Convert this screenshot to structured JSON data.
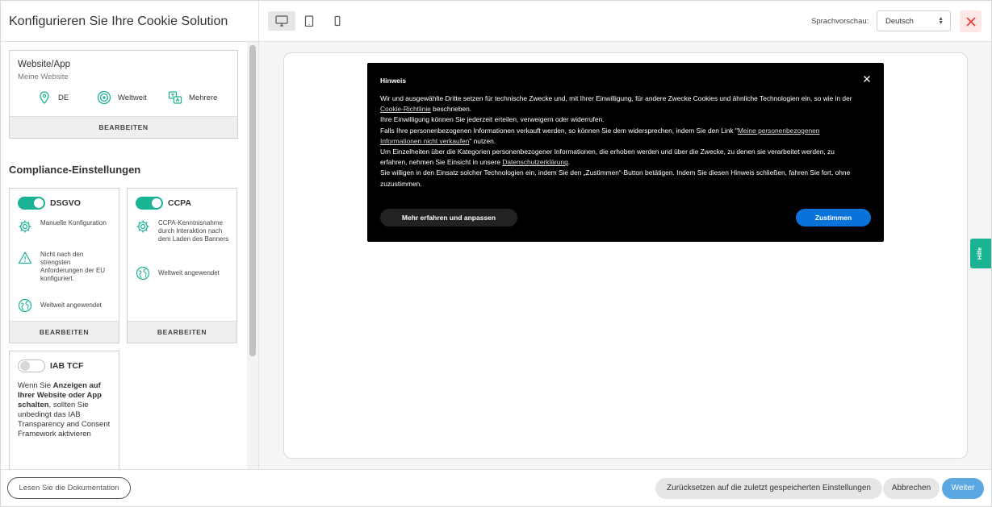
{
  "app_title": "Konfigurieren Sie Ihre Cookie Solution",
  "site_card": {
    "title": "Website/App",
    "subtitle": "Meine Website",
    "location": "DE",
    "scope": "Weltweit",
    "languages": "Mehrere",
    "edit_label": "BEARBEITEN"
  },
  "compliance": {
    "section_title": "Compliance-Einstellungen",
    "gdpr": {
      "label": "DSGVO",
      "enabled": true,
      "features": [
        "Manuelle Konfiguration",
        "Nicht nach den strengsten Anforderungen der EU konfiguriert.",
        "Weltweit angewendet"
      ],
      "edit_label": "BEARBEITEN"
    },
    "ccpa": {
      "label": "CCPA",
      "enabled": true,
      "features": [
        "CCPA-Kenntnisnahme durch Interaktion nach dem Laden des Banners",
        "Weltweit angewendet"
      ],
      "edit_label": "BEARBEITEN"
    },
    "iab": {
      "label": "IAB TCF",
      "enabled": false,
      "text_pre": "Wenn Sie ",
      "text_bold": "Anzeigen auf Ihrer Website oder App schalten",
      "text_post": ", sollten Sie unbedingt das IAB Transparency and Consent Framework aktivieren"
    }
  },
  "topbar": {
    "language_label": "Sprachvorschau:",
    "language_value": "Deutsch",
    "active_device": "desktop"
  },
  "banner": {
    "title": "Hinweis",
    "p1_pre": "Wir und ausgewählte Dritte setzen für technische Zwecke und, mit Ihrer Einwilligung, für andere Zwecke Cookies und ähnliche Technologien ein, so wie in der ",
    "p1_link": "Cookie-Richtlinie",
    "p1_post": " beschrieben.",
    "p2": "Ihre Einwilligung können Sie jederzeit erteilen, verweigern oder widerrufen.",
    "p3_pre": "Falls Ihre personenbezogenen Informationen verkauft werden, so können Sie dem widersprechen, indem Sie den Link \"",
    "p3_link": "Meine personenbezogenen Informationen nicht verkaufen",
    "p3_post": "\" nutzen.",
    "p4_pre": "Um Einzelheiten über die Kategorien personenbezogener Informationen, die erhoben werden und über die Zwecke, zu denen sie verarbeitet werden, zu erfahren, nehmen Sie Einsicht in unsere ",
    "p4_link": "Datenschutzerklärung",
    "p4_post": ".",
    "p5": "Sie willigen in den Einsatz solcher Technologien ein, indem Sie den „Zustimmen“-Button betätigen. Indem Sie diesen Hinweis schließen, fahren Sie fort, ohne zuzustimmen.",
    "learn_more": "Mehr erfahren und anpassen",
    "accept": "Zustimmen"
  },
  "help_tab": "Hilfe",
  "bottombar": {
    "docs": "Lesen Sie die Dokumentation",
    "reset": "Zurücksetzen auf die zuletzt gespeicherten Einstellungen",
    "cancel": "Abbrechen",
    "next": "Weiter"
  },
  "colors": {
    "accent_green": "#1ab394",
    "accept_blue": "#0a73d9",
    "next_blue": "#5ba8e2",
    "close_red": "#e53935"
  }
}
